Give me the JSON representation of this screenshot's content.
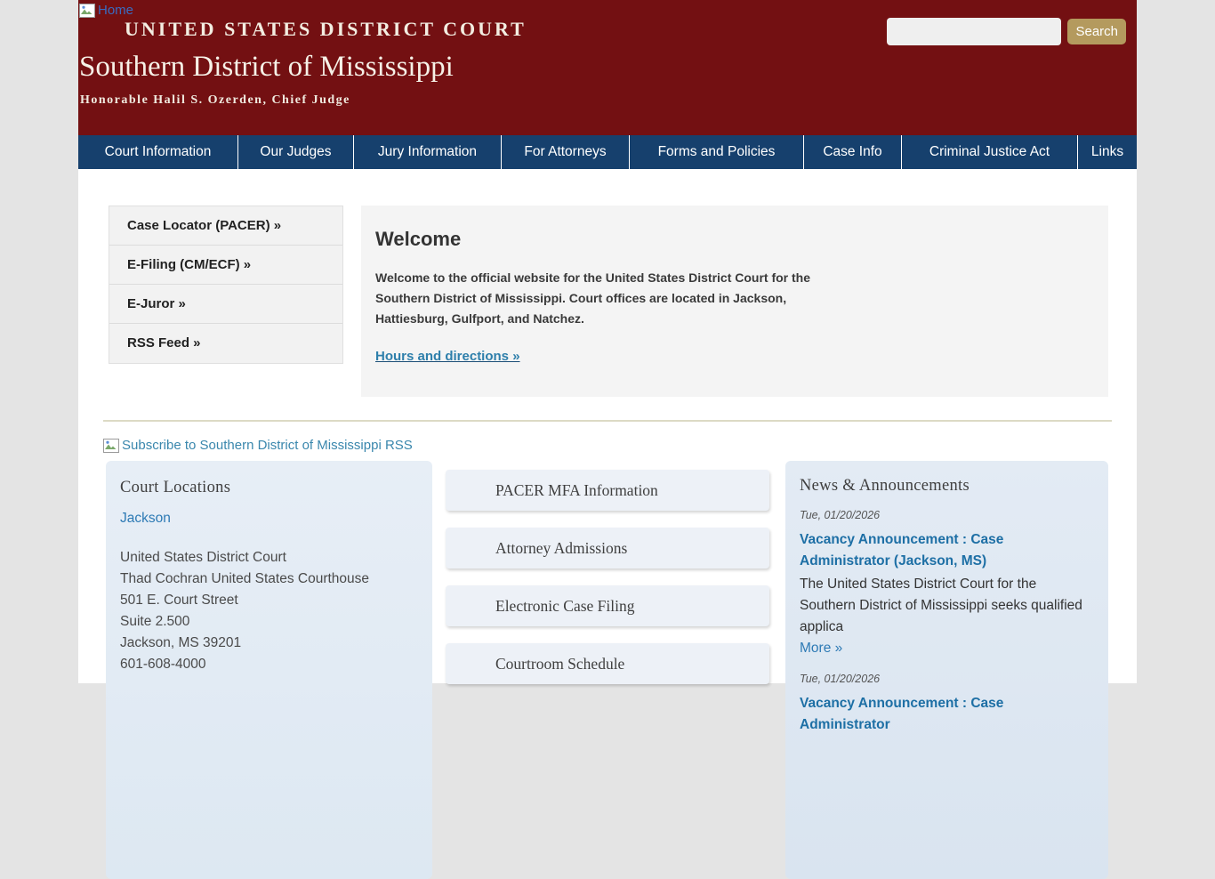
{
  "header": {
    "home_link_label": "Home",
    "eyebrow": "UNITED STATES DISTRICT COURT",
    "site_name": "Southern District of Mississippi",
    "tagline": "Honorable Halil S. Ozerden, Chief Judge",
    "search": {
      "value": "",
      "button_label": "Search"
    }
  },
  "nav": {
    "items": [
      "Court Information",
      "Our Judges",
      "Jury Information",
      "For Attorneys",
      "Forms and Policies",
      "Case Info",
      "Criminal Justice Act",
      "Links"
    ]
  },
  "sidebar": {
    "items": [
      "Case Locator (PACER) »",
      "E-Filing (CM/ECF) »",
      "E-Juror »",
      "RSS Feed »"
    ]
  },
  "welcome": {
    "title": "Welcome",
    "body": "Welcome to the official website for the United States District Court for the Southern District of Mississippi. Court offices are located in Jackson, Hattiesburg, Gulfport, and Natchez.",
    "link_label": "Hours and directions »"
  },
  "rss": {
    "subscribe_label": "Subscribe to Southern District of Mississippi RSS"
  },
  "locations": {
    "title": "Court Locations",
    "city_link": "Jackson",
    "address_lines": [
      "United States District Court",
      "Thad Cochran United States Courthouse",
      "501 E. Court Street",
      "Suite 2.500",
      "Jackson, MS 39201",
      "601-608-4000"
    ]
  },
  "quick_links": {
    "items": [
      "PACER MFA Information",
      "Attorney Admissions",
      "Electronic Case Filing",
      "Courtroom Schedule"
    ]
  },
  "news": {
    "title": "News & Announcements",
    "items": [
      {
        "date": "Tue, 01/20/2026",
        "title": "Vacancy Announcement : Case Administrator (Jackson, MS)",
        "excerpt": "The United States District Court for the Southern District of Mississippi seeks qualified applica",
        "more_label": "More »"
      },
      {
        "date": "Tue, 01/20/2026",
        "title": "Vacancy Announcement : Case Administrator",
        "excerpt": "",
        "more_label": ""
      }
    ]
  },
  "colors": {
    "header_maroon": "#731012",
    "nav_navy": "#16406d",
    "search_button_gold": "#b49a5e",
    "link_blue": "#2d7ab5",
    "news_link_blue": "#1d6fa5",
    "divider_tan": "#dcdac5"
  }
}
